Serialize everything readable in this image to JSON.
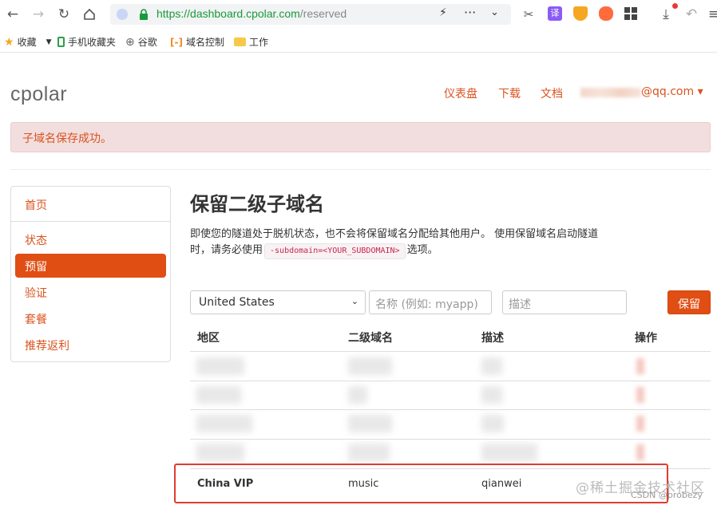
{
  "browser": {
    "url": {
      "protocol": "https://",
      "host": "dashboard.cpolar.com",
      "path": "/reserved"
    },
    "bookmarks": [
      {
        "label": "收藏",
        "icon": "star-icon"
      },
      {
        "label": "手机收藏夹",
        "icon": "phone-icon"
      },
      {
        "label": "谷歌",
        "icon": "globe-icon"
      },
      {
        "label": "域名控制",
        "icon": "bracket-icon"
      },
      {
        "label": "工作",
        "icon": "folder-icon"
      }
    ]
  },
  "header": {
    "logo": "cpolar",
    "nav": {
      "dashboard": "仪表盘",
      "download": "下载",
      "docs": "文档"
    },
    "user_suffix": "@qq.com ▾"
  },
  "alert": {
    "message": "子域名保存成功。"
  },
  "sidebar": {
    "items": [
      {
        "label": "首页"
      },
      {
        "label": "状态"
      },
      {
        "label": "预留"
      },
      {
        "label": "验证"
      },
      {
        "label": "套餐"
      },
      {
        "label": "推荐返利"
      }
    ],
    "active_index": 2
  },
  "main": {
    "title": "保留二级子域名",
    "desc_part1": "即使您的隧道处于脱机状态，也不会将保留域名分配给其他用户。 使用保留域名启动隧道",
    "desc_part2": "时，请务必使用",
    "desc_code": "-subdomain=<YOUR_SUBDOMAIN>",
    "desc_part3": "选项。",
    "form": {
      "region_selected": "United States",
      "name_placeholder": "名称 (例如: myapp)",
      "desc_placeholder": "描述",
      "save_label": "保留"
    },
    "table": {
      "headers": [
        "地区",
        "二级域名",
        "描述",
        "操作"
      ],
      "highlighted_row": {
        "region": "China VIP",
        "subdomain": "music",
        "description": "qianwei"
      }
    }
  },
  "watermark": {
    "main": "@稀土掘金技术社区",
    "sub": "CSDN @probezy"
  },
  "colors": {
    "accent": "#e04e14",
    "link": "#d9531e",
    "alert_bg": "#f2dede",
    "highlight_box": "#e03b32"
  }
}
